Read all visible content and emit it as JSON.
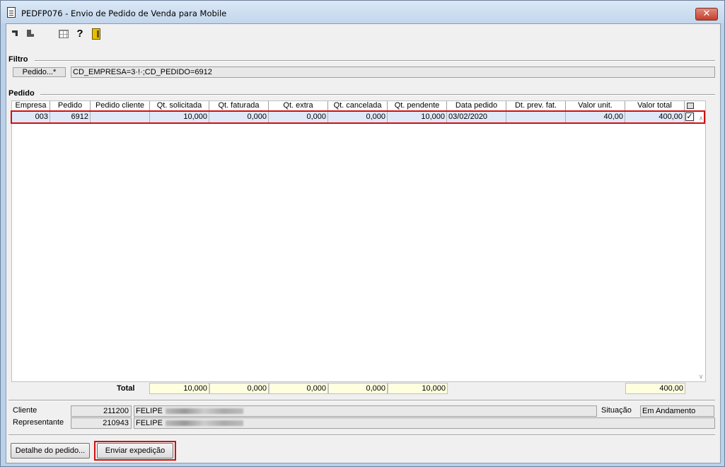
{
  "window": {
    "title": "PEDFP076 - Envio de Pedido de Venda para Mobile",
    "close_label": "✕"
  },
  "toolbar": {
    "icons": [
      "first-record-icon",
      "last-record-icon",
      "grid-icon",
      "help-icon",
      "exit-icon"
    ]
  },
  "filtro": {
    "label": "Filtro",
    "button_label": "Pedido...*",
    "value": "CD_EMPRESA=3·!·;CD_PEDIDO=6912"
  },
  "pedido": {
    "label": "Pedido",
    "columns": [
      "Empresa",
      "Pedido",
      "Pedido cliente",
      "Qt. solicitada",
      "Qt. faturada",
      "Qt. extra",
      "Qt. cancelada",
      "Qt. pendente",
      "Data pedido",
      "Dt. prev. fat.",
      "Valor unit.",
      "Valor total"
    ],
    "rows": [
      {
        "empresa": "003",
        "pedido": "6912",
        "pedido_cliente": "",
        "qt_solicitada": "10,000",
        "qt_faturada": "0,000",
        "qt_extra": "0,000",
        "qt_cancelada": "0,000",
        "qt_pendente": "10,000",
        "data_pedido": "03/02/2020",
        "dt_prev_fat": "",
        "valor_unit": "40,00",
        "valor_total": "400,00",
        "checked": "✓"
      }
    ]
  },
  "totals": {
    "label": "Total",
    "qt_solicitada": "10,000",
    "qt_faturada": "0,000",
    "qt_extra": "0,000",
    "qt_cancelada": "0,000",
    "qt_pendente": "10,000",
    "valor_total": "400,00"
  },
  "info": {
    "cliente_label": "Cliente",
    "cliente_code": "211200",
    "cliente_name": "FELIPE",
    "representante_label": "Representante",
    "representante_code": "210943",
    "representante_name": "FELIPE",
    "situacao_label": "Situação",
    "situacao_value": "Em Andamento"
  },
  "buttons": {
    "detalhe": "Detalhe do pedido...",
    "enviar": "Enviar expedição"
  },
  "colors": {
    "highlight": "#d01010",
    "total_bg": "#ffffe0",
    "selected_row": "#e0e8f8"
  }
}
